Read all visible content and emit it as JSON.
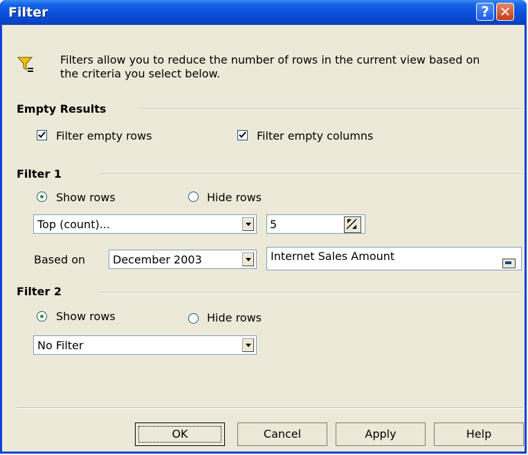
{
  "window": {
    "title": "Filter",
    "help_glyph": "?",
    "close_glyph": "✕"
  },
  "intro": {
    "text_line1": "Filters allow you to reduce the number of rows in the current view based on",
    "text_line2": "the criteria you select below.",
    "icon": "filter-funnel-icon"
  },
  "empty_results": {
    "heading": "Empty Results",
    "filter_rows_label": "Filter empty rows",
    "filter_rows_checked": true,
    "filter_columns_label": "Filter empty columns",
    "filter_columns_checked": true
  },
  "filter1": {
    "heading": "Filter 1",
    "show_rows_label": "Show rows",
    "hide_rows_label": "Hide rows",
    "selected": "show",
    "type_value": "Top (count)...",
    "count_value": "5",
    "based_on_label": "Based on",
    "based_on_value": "December 2003",
    "measure_value": "Internet Sales Amount"
  },
  "filter2": {
    "heading": "Filter 2",
    "show_rows_label": "Show rows",
    "hide_rows_label": "Hide rows",
    "selected": "show",
    "type_value": "No Filter"
  },
  "buttons": {
    "ok": "OK",
    "cancel": "Cancel",
    "apply": "Apply",
    "help": "Help"
  },
  "colors": {
    "titlebar": "#0a4ed8",
    "face": "#ece9d8",
    "border": "#7f9db9",
    "radio_dot": "#1f9a2c"
  }
}
